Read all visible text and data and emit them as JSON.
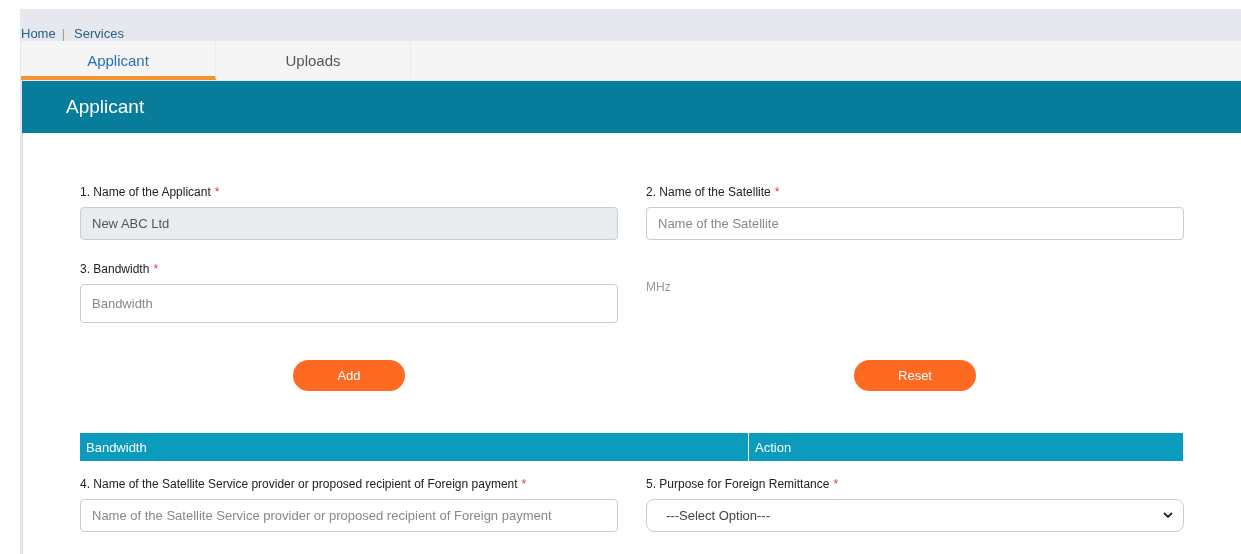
{
  "breadcrumb": {
    "items": [
      "Home",
      "Services"
    ],
    "separator": "|"
  },
  "tabs": [
    {
      "label": "Applicant",
      "selected": true
    },
    {
      "label": "Uploads",
      "selected": false
    }
  ],
  "panel": {
    "title": "Applicant"
  },
  "fields_top": [
    {
      "label": "1. Name of the Applicant",
      "required_mark": "*",
      "kind": "text",
      "value": "New ABC Ltd",
      "disabled": true
    },
    {
      "label": "2. Name of the Satellite",
      "required_mark": "*",
      "kind": "text",
      "placeholder": "Name of the Satellite",
      "disabled": false
    },
    {
      "label": "3. Bandwidth",
      "required_mark": "*",
      "kind": "text",
      "placeholder": "Bandwidth",
      "disabled": false
    },
    {
      "kind": "unit",
      "text": "MHz"
    }
  ],
  "buttons": [
    "Add",
    "Reset"
  ],
  "table": {
    "columns": [
      "Bandwidth",
      "Action"
    ]
  },
  "fields_bottom": [
    {
      "label": "4. Name of the Satellite Service provider or proposed recipient of Foreign payment",
      "required_mark": "*",
      "kind": "text",
      "placeholder": "Name of the Satellite Service provider or proposed recipient of Foreign payment",
      "disabled": false
    },
    {
      "label": "5. Purpose for Foreign Remittance",
      "required_mark": "*",
      "kind": "select",
      "value": "---Select Option---",
      "disabled": false
    }
  ]
}
